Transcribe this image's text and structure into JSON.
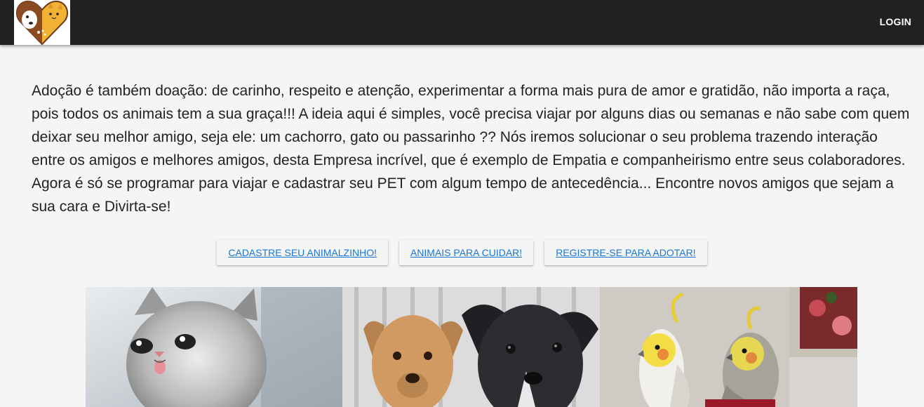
{
  "header": {
    "logo_name": "pet-care-logo",
    "login_label": "LOGIN"
  },
  "intro": {
    "text": "Adoção é também doação: de carinho, respeito e atenção, experimentar a forma mais pura de amor e gratidão, não importa a raça, pois todos os animais tem a sua graça!!! A ideia aqui é simples, você precisa viajar por alguns dias ou semanas e não sabe com quem deixar seu melhor amigo, seja ele: um cachorro, gato ou passarinho ?? Nós iremos solucionar o seu problema trazendo interação entre os amigos e melhores amigos, desta Empresa incrível, que é exemplo de Empatia e companheirismo entre seus colaboradores. Agora é só se programar para viajar e cadastrar seu PET com algum tempo de antecedência... Encontre novos amigos que sejam a sua cara e Divirta-se!"
  },
  "actions": {
    "register_pet": "CADASTRE SEU ANIMALZINHO!",
    "animals_to_care": "ANIMAIS PARA CUIDAR!",
    "register_adopt": "REGISTRE-SE PARA ADOTAR!"
  },
  "gallery": {
    "images": [
      "kitten-photo",
      "puppies-photo",
      "cockatiels-photo"
    ]
  },
  "colors": {
    "appbar": "#212121",
    "link": "#1976d2",
    "background": "#f5f5f5"
  }
}
